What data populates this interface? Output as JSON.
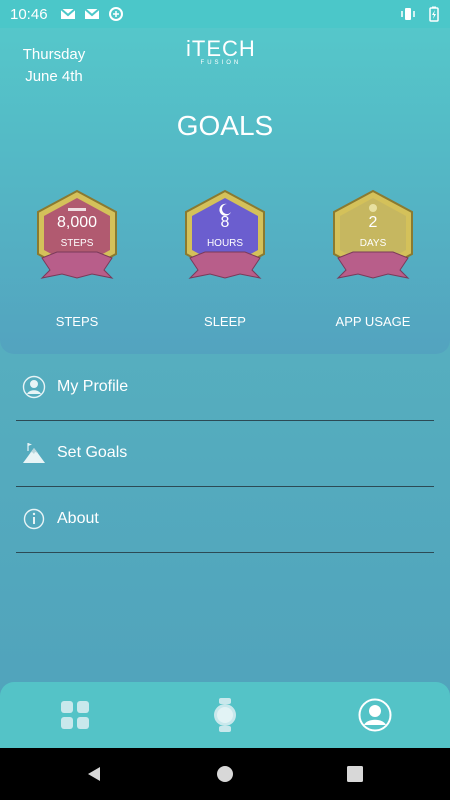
{
  "status_bar": {
    "time": "10:46"
  },
  "header": {
    "date_day": "Thursday",
    "date_month": "June 4th",
    "logo_main": "iTECH",
    "logo_sub": "FUSION",
    "title": "GOALS"
  },
  "goals": [
    {
      "value": "8,000",
      "unit": "STEPS",
      "label": "STEPS",
      "color": "#b15a70"
    },
    {
      "value": "8",
      "unit": "HOURS",
      "label": "SLEEP",
      "color": "#6b5ecf"
    },
    {
      "value": "2",
      "unit": "DAYS",
      "label": "APP USAGE",
      "color": "#c6b760"
    }
  ],
  "menu": [
    {
      "label": "My Profile",
      "icon": "profile-icon"
    },
    {
      "label": "Set Goals",
      "icon": "mountain-flag-icon"
    },
    {
      "label": "About",
      "icon": "info-icon"
    }
  ],
  "bottom_nav": [
    "dashboard-grid-icon",
    "watch-icon",
    "profile-icon"
  ],
  "colors": {
    "accent": "#55c7ca",
    "badge_frame": "#d4c15a",
    "ribbon": "#b85e8a"
  }
}
